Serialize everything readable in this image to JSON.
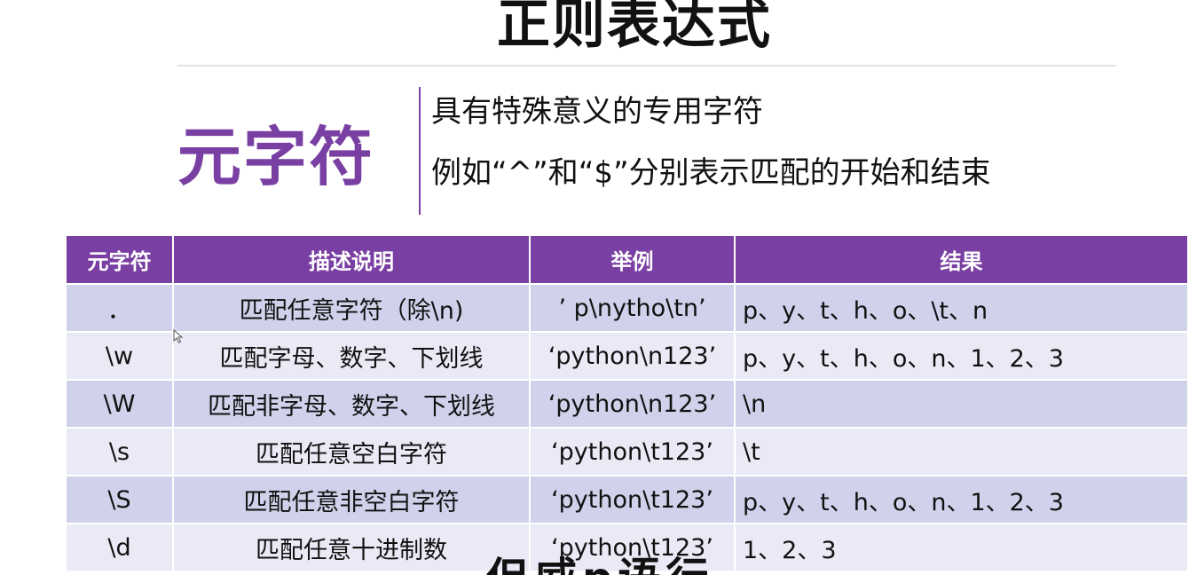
{
  "slide": {
    "title": "正则表达式",
    "term": "元字符",
    "definition": "具有特殊意义的专用字符",
    "example": "例如“^”和“$”分别表示匹配的开始和结束"
  },
  "table": {
    "headers": [
      "元字符",
      "描述说明",
      "举例",
      "结果"
    ],
    "rows": [
      [
        "．",
        "匹配任意字符（除\\n)",
        "’ p\\nytho\\tn’",
        "p、y、t、h、o、\\t、n"
      ],
      [
        "\\w",
        "匹配字母、数字、下划线",
        "‘python\\n123’",
        "p、y、t、h、o、n、1、2、3"
      ],
      [
        "\\W",
        "匹配非字母、数字、下划线",
        "‘python\\n123’",
        "\\n"
      ],
      [
        "\\s",
        "匹配任意空白字符",
        "‘python\\t123’",
        "\\t"
      ],
      [
        "\\S",
        "匹配任意非空白字符",
        "‘python\\t123’",
        "p、y、t、h、o、n、1、2、3"
      ],
      [
        "\\d",
        "匹配任意十进制数",
        "‘python\\t123’",
        "1、2、3"
      ]
    ]
  },
  "overlay": {
    "caption": "但威p语行"
  },
  "colors": {
    "accent": "#7a3fa2",
    "row_odd": "#cfd2ea",
    "row_even": "#e9eaf5"
  },
  "icons": {
    "cursor": "mouse-pointer-icon"
  }
}
